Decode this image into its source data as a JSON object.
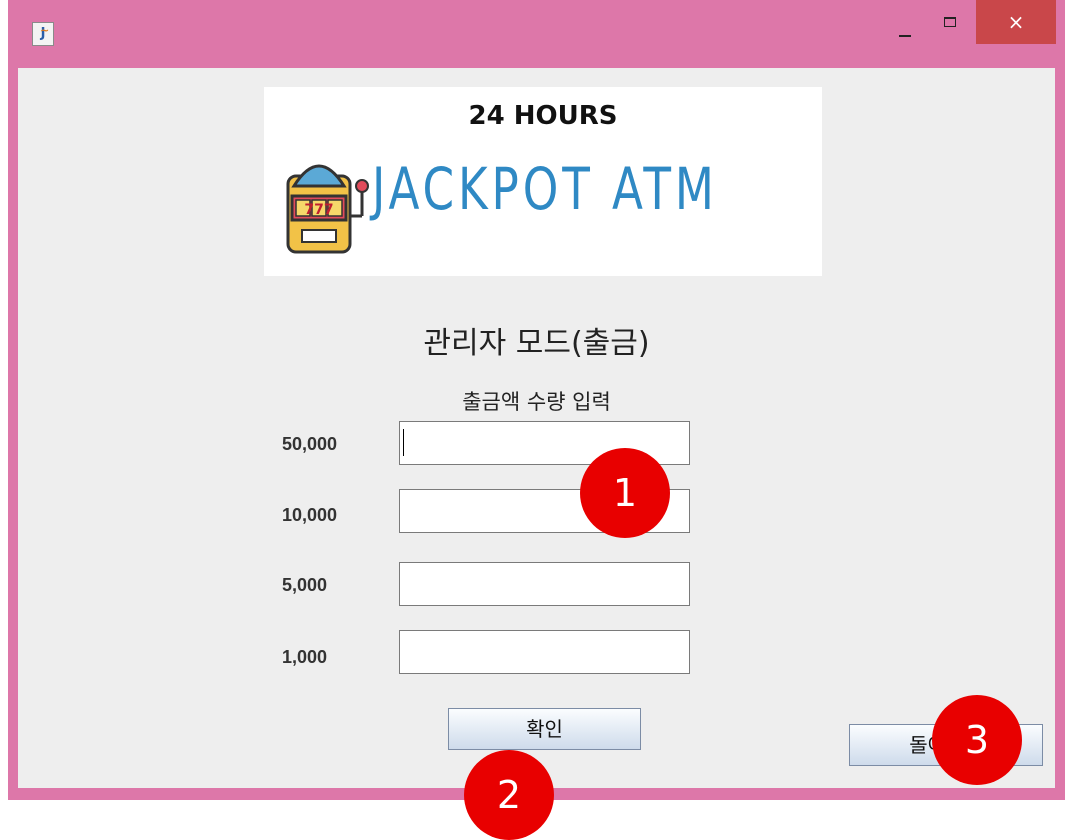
{
  "window": {
    "title": "",
    "close_glyph": "×"
  },
  "banner": {
    "top_text": "24 HOURS",
    "logo_text": "JACKPOT ATM",
    "slot_digits": "777",
    "icon": "slot-machine-icon"
  },
  "page": {
    "title": "관리자 모드(출금)",
    "subtitle": "출금액 수량 입력"
  },
  "denominations": [
    {
      "label": "50,000",
      "value": ""
    },
    {
      "label": "10,000",
      "value": ""
    },
    {
      "label": "5,000",
      "value": ""
    },
    {
      "label": "1,000",
      "value": ""
    }
  ],
  "buttons": {
    "confirm": "확인",
    "back": "돌아가기"
  },
  "markers": [
    "1",
    "2",
    "3"
  ],
  "colors": {
    "title_bar": "#dd77a9",
    "close_button": "#c9474a",
    "logo_blue": "#2f89c4",
    "marker_red": "#e80000"
  }
}
